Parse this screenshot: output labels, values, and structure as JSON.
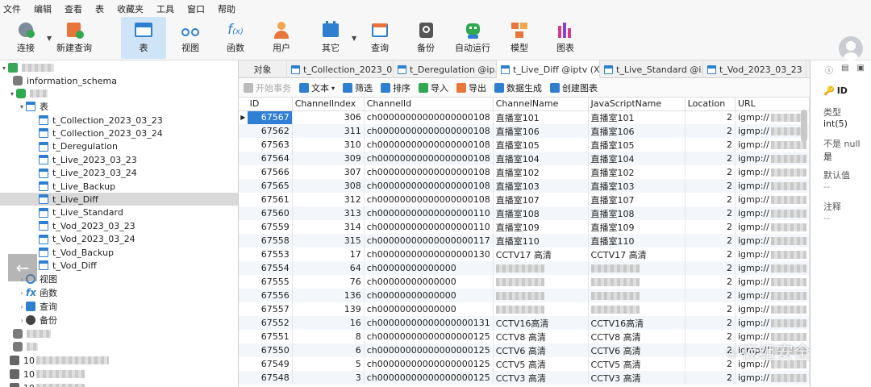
{
  "menu": [
    "文件",
    "编辑",
    "查看",
    "表",
    "收藏夹",
    "工具",
    "窗口",
    "帮助"
  ],
  "toolbar": [
    {
      "label": "连接",
      "icon": "connect-icon",
      "dropdown": true
    },
    {
      "label": "新建查询",
      "icon": "new-query-icon"
    },
    {
      "label": "表",
      "icon": "table-icon",
      "active": true
    },
    {
      "label": "视图",
      "icon": "view-icon"
    },
    {
      "label": "函数",
      "icon": "function-icon"
    },
    {
      "label": "用户",
      "icon": "user-icon"
    },
    {
      "label": "其它",
      "icon": "other-icon",
      "dropdown": true
    },
    {
      "label": "查询",
      "icon": "query-icon"
    },
    {
      "label": "备份",
      "icon": "backup-icon"
    },
    {
      "label": "自动运行",
      "icon": "robot-icon"
    },
    {
      "label": "模型",
      "icon": "model-icon"
    },
    {
      "label": "图表",
      "icon": "chart-icon"
    }
  ],
  "sidebar": {
    "schema": "information_schema",
    "tables_label": "表",
    "tables": [
      "t_Collection_2023_03_23",
      "t_Collection_2023_03_24",
      "t_Deregulation",
      "t_Live_2023_03_23",
      "t_Live_2023_03_24",
      "t_Live_Backup",
      "t_Live_Diff",
      "t_Live_Standard",
      "t_Vod_2023_03_23",
      "t_Vod_2023_03_24",
      "t_Vod_Backup",
      "t_Vod_Diff"
    ],
    "selected_table": "t_Live_Diff",
    "groups": [
      "视图",
      "函数",
      "查询",
      "备份"
    ],
    "servers": [
      "10",
      "10",
      "10"
    ]
  },
  "tabs": [
    "对象",
    "t_Collection_2023_0...",
    "t_Deregulation @ip...",
    "t_Live_Diff @iptv (X...",
    "t_Live_Standard @i...",
    "t_Vod_2023_03_23 ..."
  ],
  "active_tab": 3,
  "datatools": [
    {
      "label": "开始事务",
      "icon": "transaction-icon",
      "disabled": true
    },
    {
      "label": "文本",
      "icon": "text-icon",
      "dropdown": true
    },
    {
      "label": "筛选",
      "icon": "filter-icon"
    },
    {
      "label": "排序",
      "icon": "sort-icon"
    },
    {
      "label": "导入",
      "icon": "import-icon"
    },
    {
      "label": "导出",
      "icon": "export-icon"
    },
    {
      "label": "数据生成",
      "icon": "data-gen-icon"
    },
    {
      "label": "创建图表",
      "icon": "create-chart-icon"
    }
  ],
  "grid": {
    "columns": [
      "ID",
      "ChannelIndex",
      "ChannelId",
      "ChannelName",
      "JavaScriptName",
      "Location",
      "URL"
    ],
    "rows": [
      [
        "67567",
        "306",
        "ch00000000000000000108",
        "直播室101",
        "直播室101",
        "2",
        "igmp://"
      ],
      [
        "67562",
        "311",
        "ch00000000000000000108",
        "直播室106",
        "直播室106",
        "2",
        "igmp://"
      ],
      [
        "67563",
        "310",
        "ch00000000000000000108",
        "直播室105",
        "直播室105",
        "2",
        "igmp://"
      ],
      [
        "67564",
        "309",
        "ch00000000000000000108",
        "直播室104",
        "直播室104",
        "2",
        "igmp://"
      ],
      [
        "67566",
        "307",
        "ch00000000000000000108",
        "直播室102",
        "直播室102",
        "2",
        "igmp://"
      ],
      [
        "67565",
        "308",
        "ch00000000000000000108",
        "直播室103",
        "直播室103",
        "2",
        "igmp://"
      ],
      [
        "67561",
        "312",
        "ch00000000000000000108",
        "直播室107",
        "直播室107",
        "2",
        "igmp://"
      ],
      [
        "67560",
        "313",
        "ch00000000000000000110",
        "直播室108",
        "直播室108",
        "2",
        "igmp://"
      ],
      [
        "67559",
        "314",
        "ch00000000000000000110",
        "直播室109",
        "直播室109",
        "2",
        "igmp://"
      ],
      [
        "67558",
        "315",
        "ch00000000000000000117",
        "直播室110",
        "直播室110",
        "2",
        "igmp://"
      ],
      [
        "67553",
        "17",
        "ch00000000000000000130",
        "CCTV17 高清",
        "CCTV17 高清",
        "2",
        "igmp://"
      ],
      [
        "67554",
        "64",
        "ch00000000000000",
        "",
        "",
        "2",
        "igmp://"
      ],
      [
        "67555",
        "76",
        "ch00000000000000",
        "",
        "",
        "2",
        "igmp://"
      ],
      [
        "67556",
        "136",
        "ch00000000000000",
        "",
        "",
        "2",
        "igmp://"
      ],
      [
        "67557",
        "139",
        "ch00000000000000",
        "",
        "",
        "2",
        "igmp://"
      ],
      [
        "67552",
        "16",
        "ch00000000000000000131",
        "CCTV16高清",
        "CCTV16高清",
        "2",
        "igmp://"
      ],
      [
        "67551",
        "8",
        "ch00000000000000000125",
        "CCTV8 高清",
        "CCTV8 高清",
        "2",
        "igmp://"
      ],
      [
        "67550",
        "6",
        "ch00000000000000000125",
        "CCTV6 高清",
        "CCTV6 高清",
        "2",
        "igmp://"
      ],
      [
        "67549",
        "5",
        "ch00000000000000000125",
        "CCTV5 高清",
        "CCTV5 高清",
        "2",
        "igmp://"
      ],
      [
        "67548",
        "3",
        "ch00000000000000000125",
        "CCTV3 高清",
        "CCTV3 高清",
        "2",
        "igmp://"
      ]
    ]
  },
  "panel": {
    "field": "ID",
    "type_label": "类型",
    "type_value": "int(5)",
    "null_label": "不是 null",
    "null_value": "是",
    "default_label": "默认值",
    "default_value": "--",
    "comment_label": "注释",
    "comment_value": "--"
  },
  "watermark": "夜组安全"
}
